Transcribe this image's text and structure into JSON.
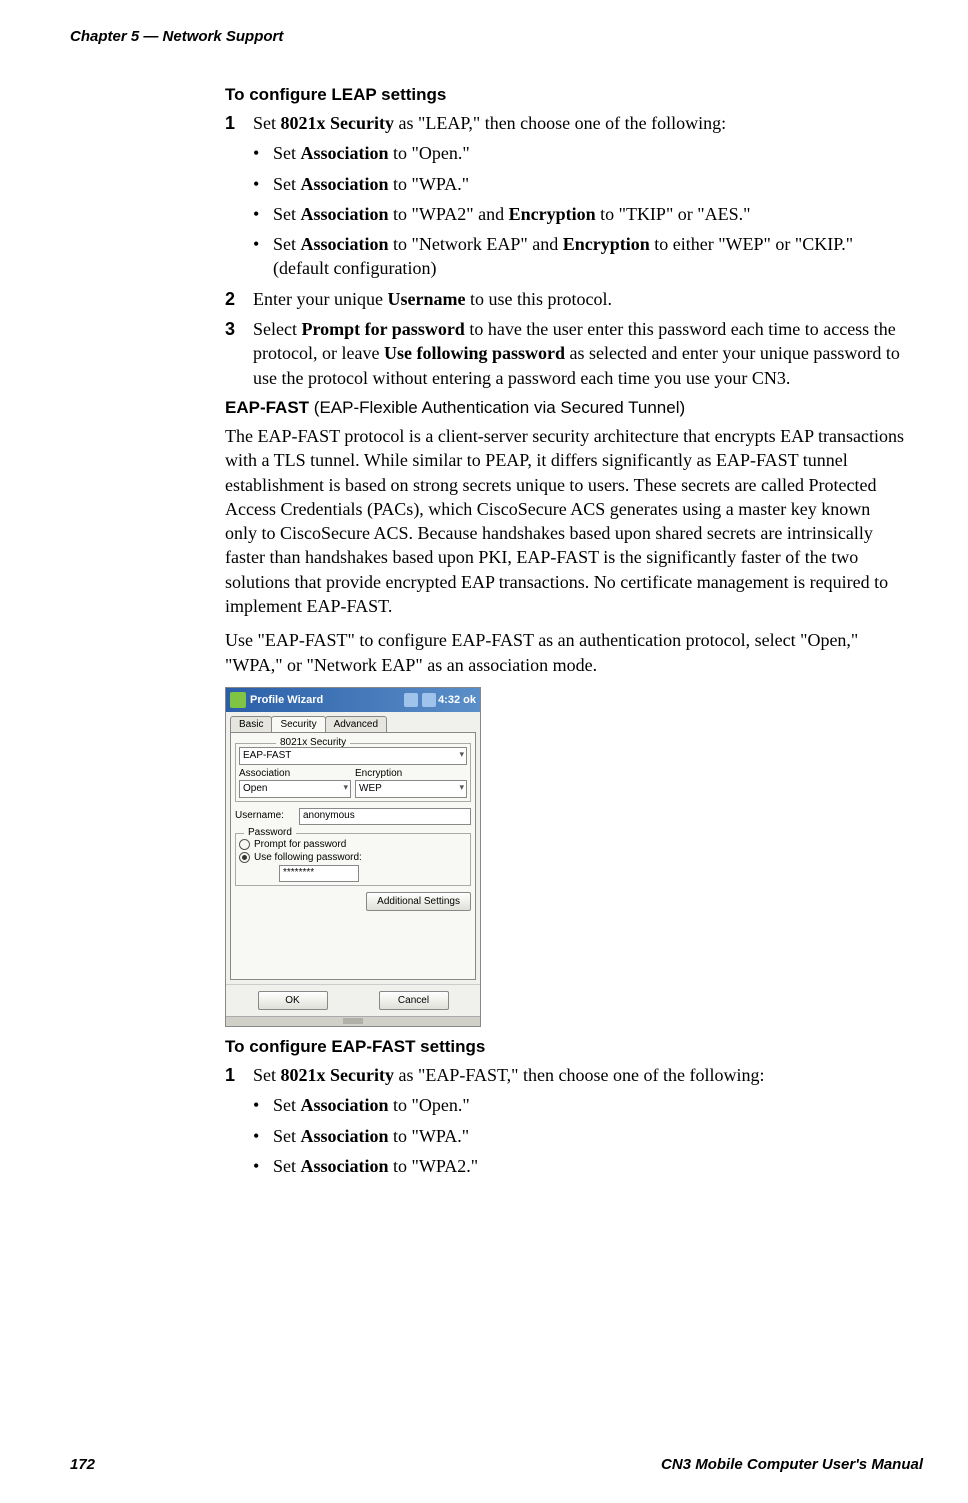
{
  "header": {
    "chapter": "Chapter 5 — Network Support"
  },
  "leap": {
    "heading": "To configure LEAP settings",
    "step1_pre": "Set ",
    "step1_bold": "8021x Security",
    "step1_post": " as \"LEAP,\" then choose one of the following:",
    "bullets": {
      "b1_pre": "Set ",
      "b1_bold": "Association",
      "b1_post": " to \"Open.\"",
      "b2_pre": "Set ",
      "b2_bold": "Association",
      "b2_post": " to \"WPA.\"",
      "b3_pre": "Set ",
      "b3_bold1": "Association",
      "b3_mid": " to \"WPA2\" and ",
      "b3_bold2": "Encryption",
      "b3_post": " to \"TKIP\" or \"AES.\"",
      "b4_pre": "Set ",
      "b4_bold1": "Association",
      "b4_mid": " to \"Network EAP\" and ",
      "b4_bold2": "Encryption",
      "b4_post": " to either \"WEP\" or \"CKIP.\" (default configuration)"
    },
    "step2_pre": "Enter your unique ",
    "step2_bold": "Username",
    "step2_post": " to use this protocol.",
    "step3_pre": "Select ",
    "step3_bold1": "Prompt for password",
    "step3_mid": " to have the user enter this password each time to access the protocol, or leave ",
    "step3_bold2": "Use following password",
    "step3_post": " as selected and enter your unique password to use the protocol without entering a password each time you use your CN3."
  },
  "eapfast_heading": {
    "bold": "EAP-FAST",
    "rest": " (EAP-Flexible Authentication via Secured Tunnel)"
  },
  "eapfast_para1": "The EAP-FAST protocol is a client-server security architecture that encrypts EAP transactions with a TLS tunnel. While similar to PEAP, it differs significantly as EAP-FAST tunnel establishment is based on strong secrets unique to users. These secrets are called Protected Access Credentials (PACs), which CiscoSecure ACS generates using a master key known only to CiscoSecure ACS. Because handshakes based upon shared secrets are intrinsically faster than handshakes based upon PKI, EAP-FAST is the significantly faster of the two solutions that provide encrypted EAP transactions. No certificate management is required to implement EAP-FAST.",
  "eapfast_para2": "Use \"EAP-FAST\" to configure EAP-FAST as an authentication protocol, select \"Open,\" \"WPA,\" or \"Network EAP\" as an association mode.",
  "wizard": {
    "title": "Profile Wizard",
    "time": "4:32",
    "ok": "ok",
    "tabs": {
      "basic": "Basic",
      "security": "Security",
      "advanced": "Advanced"
    },
    "sec_label": "8021x Security",
    "sec_value": "EAP-FAST",
    "assoc_label": "Association",
    "assoc_value": "Open",
    "enc_label": "Encryption",
    "enc_value": "WEP",
    "user_label": "Username:",
    "user_value": "anonymous",
    "pass_legend": "Password",
    "radio_prompt": "Prompt for password",
    "radio_use": "Use following password:",
    "pass_value": "********",
    "addl_btn": "Additional Settings",
    "ok_btn": "OK",
    "cancel_btn": "Cancel"
  },
  "eapfast_config": {
    "heading": "To configure EAP-FAST settings",
    "step1_pre": "Set ",
    "step1_bold": "8021x Security",
    "step1_post": " as \"EAP-FAST,\" then choose one of the following:",
    "bullets": {
      "b1_pre": "Set ",
      "b1_bold": "Association",
      "b1_post": " to \"Open.\"",
      "b2_pre": "Set ",
      "b2_bold": "Association",
      "b2_post": " to \"WPA.\"",
      "b3_pre": "Set ",
      "b3_bold": "Association",
      "b3_post": " to \"WPA2.\""
    }
  },
  "footer": {
    "page": "172",
    "title": "CN3 Mobile Computer User's Manual"
  },
  "nums": {
    "n1": "1",
    "n2": "2",
    "n3": "3"
  },
  "bullet_dot": "•"
}
